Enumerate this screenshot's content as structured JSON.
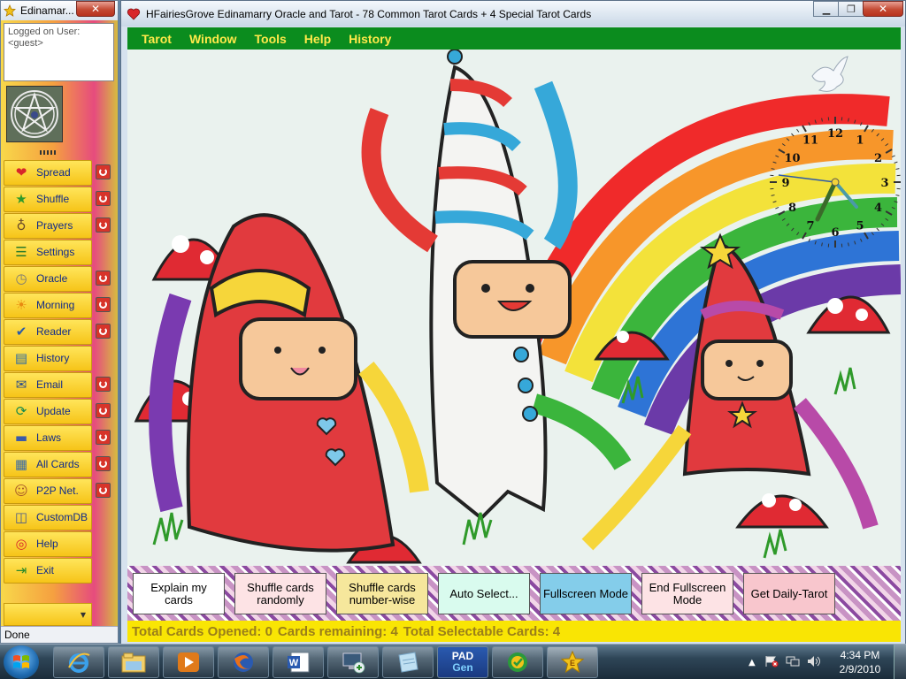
{
  "side_window": {
    "title": "Edinamar...",
    "close_glyph": "✕",
    "login_line1": "Logged on User:",
    "login_line2": "<guest>",
    "menu": [
      {
        "label": "Spread",
        "icon": "heart-icon",
        "power": true
      },
      {
        "label": "Shuffle",
        "icon": "star-icon",
        "power": true
      },
      {
        "label": "Prayers",
        "icon": "angel-icon",
        "power": true
      },
      {
        "label": "Settings",
        "icon": "settings-list-icon",
        "power": false
      },
      {
        "label": "Oracle",
        "icon": "clock-icon",
        "power": true
      },
      {
        "label": "Morning",
        "icon": "sun-icon",
        "power": true
      },
      {
        "label": "Reader",
        "icon": "reader-checklist-icon",
        "power": true
      },
      {
        "label": "History",
        "icon": "history-folder-icon",
        "power": false
      },
      {
        "label": "Email",
        "icon": "email-icon",
        "power": true
      },
      {
        "label": "Update",
        "icon": "update-globe-icon",
        "power": true
      },
      {
        "label": "Laws",
        "icon": "book-icon",
        "power": true
      },
      {
        "label": "All Cards",
        "icon": "cards-grid-icon",
        "power": true
      },
      {
        "label": "P2P Net.",
        "icon": "people-icon",
        "power": true
      },
      {
        "label": "CustomDB",
        "icon": "database-icon",
        "power": false
      },
      {
        "label": "Help",
        "icon": "lifebuoy-icon",
        "power": false
      },
      {
        "label": "Exit",
        "icon": "exit-door-icon",
        "power": false
      }
    ],
    "status": "Done"
  },
  "main_window": {
    "title": "HFairiesGrove Edinamarry Oracle and Tarot - 78 Common Tarot Cards + 4 Special Tarot Cards",
    "menubar": [
      "Tarot",
      "Window",
      "Tools",
      "Help",
      "History"
    ],
    "clock_numerals": [
      "12",
      "1",
      "2",
      "3",
      "4",
      "5",
      "6",
      "7",
      "8",
      "9",
      "10",
      "11"
    ],
    "buttons": [
      {
        "label": "Explain my cards",
        "color": "#ffffff"
      },
      {
        "label": "Shuffle cards randomly",
        "color": "#fde3e5"
      },
      {
        "label": "Shuffle cards number-wise",
        "color": "#f6e79c"
      },
      {
        "label": "Auto Select...",
        "color": "#d9fbee"
      },
      {
        "label": "Fullscreen Mode",
        "color": "#84cdea"
      },
      {
        "label": "End Fullscreen Mode",
        "color": "#fde3e5"
      },
      {
        "label": "Get Daily-Tarot",
        "color": "#f8c6cd"
      }
    ],
    "status": {
      "opened": "Total Cards Opened: 0",
      "remaining": "Cards remaining: 4",
      "selectable": "Total Selectable Cards: 4"
    }
  },
  "taskbar": {
    "apps": [
      {
        "name": "internet-explorer-icon"
      },
      {
        "name": "file-explorer-icon"
      },
      {
        "name": "media-player-icon"
      },
      {
        "name": "firefox-icon"
      },
      {
        "name": "word-icon"
      },
      {
        "name": "network-connection-icon"
      },
      {
        "name": "note-icon"
      },
      {
        "name": "pad-gen-icon",
        "label_top": "PAD",
        "label_bottom": "Gen"
      },
      {
        "name": "recycle-icon"
      },
      {
        "name": "edinamarry-app-icon"
      }
    ],
    "time": "4:34 PM",
    "date": "2/9/2010"
  },
  "colors": {
    "menubar": "#0b8c1e",
    "menubar_text": "#ffe94a",
    "status_bg": "#f9e504",
    "status_text": "#9a7e1a",
    "side_button": "#f6c418",
    "side_label": "#102a8a"
  }
}
